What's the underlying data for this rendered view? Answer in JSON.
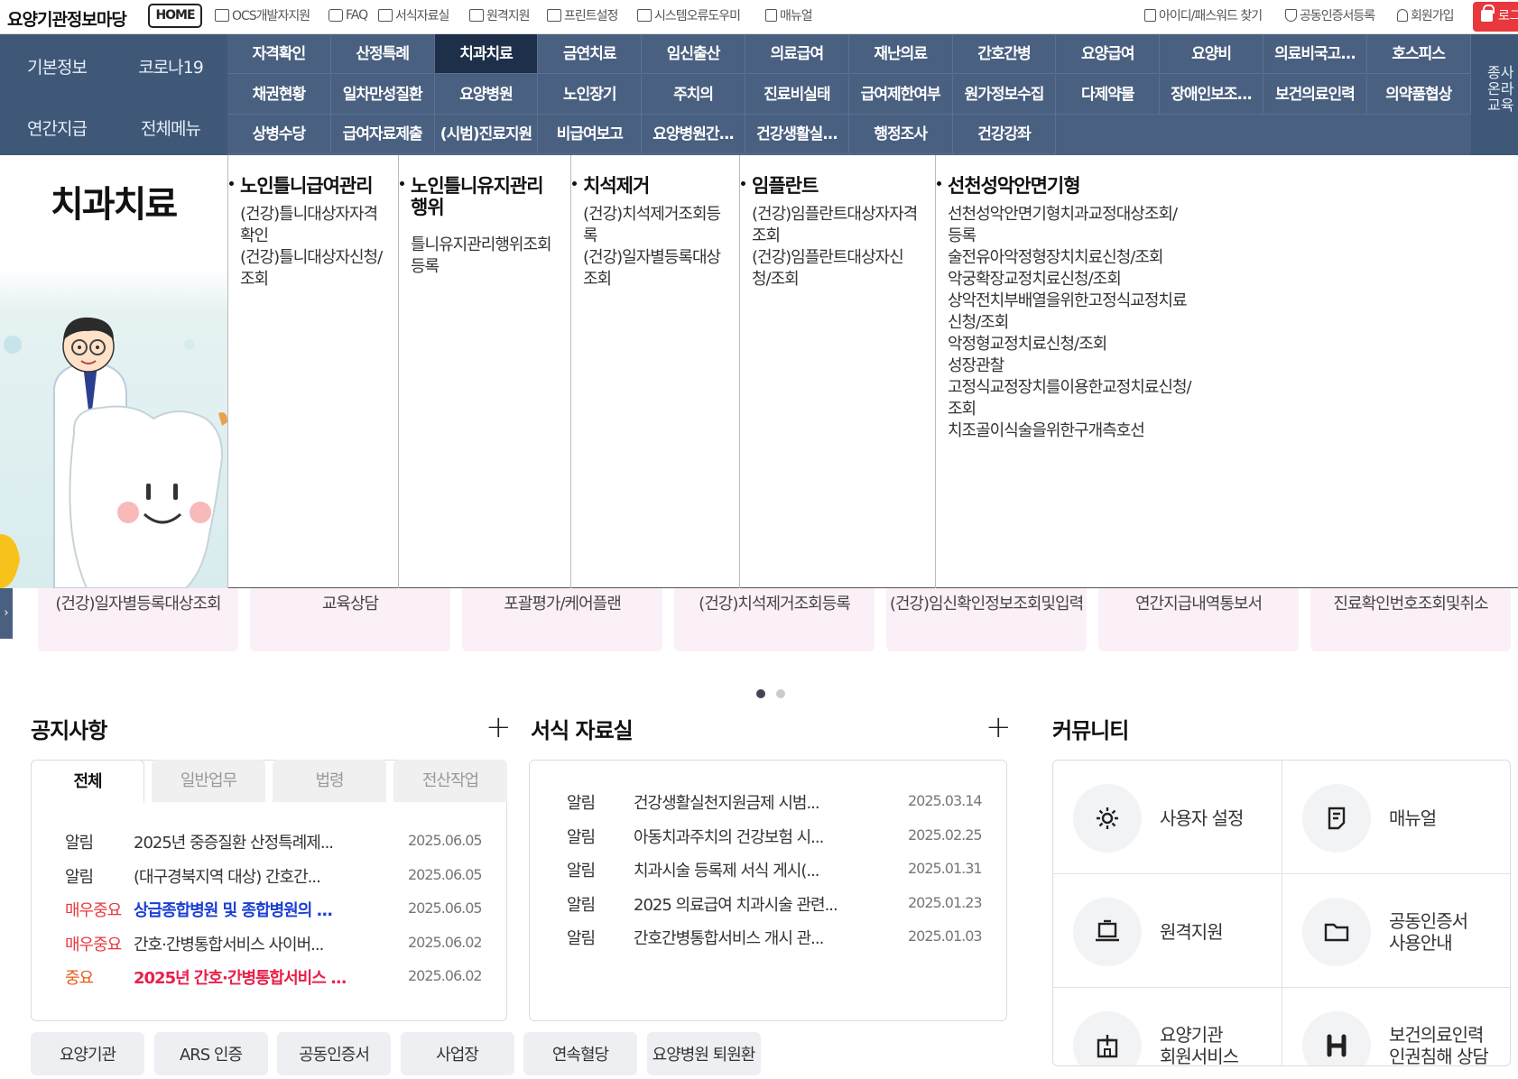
{
  "header": {
    "logo": "요양기관정보마당",
    "home": "HOME",
    "links": [
      {
        "label": "OCS개발자지원",
        "icon": "ocs-icon"
      },
      {
        "label": "FAQ",
        "icon": "chat-icon"
      },
      {
        "label": "서식자료실",
        "icon": "document-icon"
      },
      {
        "label": "원격지원",
        "icon": "monitor-icon"
      },
      {
        "label": "프린트설정",
        "icon": "printer-icon"
      },
      {
        "label": "시스템오류도우미",
        "icon": "printer-icon"
      },
      {
        "label": "매뉴얼",
        "icon": "manual-icon"
      }
    ],
    "right_links": [
      {
        "label": "아이디/패스워드 찾기",
        "icon": "id-icon"
      },
      {
        "label": "공동인증서등록",
        "icon": "shield-icon"
      },
      {
        "label": "회원가입",
        "icon": "person-icon"
      }
    ],
    "login": "로그인"
  },
  "nav": {
    "left": [
      "기본정보",
      "코로나19",
      "연간지급",
      "전체메뉴"
    ],
    "rows": [
      [
        "자격확인",
        "산정특례",
        "치과치료",
        "금연치료",
        "임신출산",
        "의료급여",
        "재난의료",
        "간호간병",
        "요양급여",
        "요양비",
        "의료비국고...",
        "호스피스"
      ],
      [
        "채권현황",
        "일차만성질환",
        "요양병원",
        "노인장기",
        "주치의",
        "진료비실태",
        "급여제한여부",
        "원가정보수집",
        "다제약물",
        "장애인보조...",
        "보건의료인력",
        "의약품협상"
      ],
      [
        "상병수당",
        "급여자료제출",
        "(시범)진료지원",
        "비급여보고",
        "요양병원간...",
        "건강생활실...",
        "행정조사",
        "건강강좌"
      ]
    ],
    "active": "치과치료",
    "right_text": [
      "종사",
      "온라",
      "교육"
    ]
  },
  "mega": {
    "title": "치과치료",
    "columns": [
      {
        "heading": [
          "노인틀니급여관리"
        ],
        "items": [
          "(건강)틀니대상자자격",
          "확인",
          "(건강)틀니대상자신청/",
          "조회"
        ]
      },
      {
        "heading": [
          "노인틀니유지관리",
          "행위"
        ],
        "items": [
          "틀니유지관리행위조회",
          "등록"
        ]
      },
      {
        "heading": [
          "치석제거"
        ],
        "items": [
          "(건강)치석제거조회등",
          "록",
          "(건강)일자별등록대상",
          "조회"
        ]
      },
      {
        "heading": [
          "임플란트"
        ],
        "items": [
          "(건강)임플란트대상자자격",
          "조회",
          "(건강)임플란트대상자신",
          "청/조회"
        ]
      },
      {
        "heading": [
          "선천성악안면기형"
        ],
        "items": [
          "선천성악안면기형치과교정대상조회/",
          "등록",
          "술전유아악정형장치치료신청/조회",
          "악궁확장교정치료신청/조회",
          "상악전치부배열을위한고정식교정치료",
          "신청/조회",
          "악정형교정치료신청/조회",
          "성장관찰",
          "고정식교정장치를이용한교정치료신청/",
          "조회",
          "치조골이식술을위한구개측호선"
        ]
      }
    ]
  },
  "quick": [
    "(건강)일자별등록대상조회",
    "교육상담",
    "포괄평가/케어플랜",
    "(건강)치석제거조회등록",
    "(건강)임신확인정보조회및입력",
    "연간지급내역통보서",
    "진료확인번호조회및취소"
  ],
  "notice": {
    "title": "공지사항",
    "tabs": [
      "전체",
      "일반업무",
      "법령",
      "전산작업"
    ],
    "rows": [
      {
        "tag": "알림",
        "text": "2025년 중증질환 산정특례제...",
        "date": "2025.06.05"
      },
      {
        "tag": "알림",
        "text": "(대구경북지역 대상) 간호간...",
        "date": "2025.06.05"
      },
      {
        "tag": "매우중요",
        "text": "상급종합병원 및 종합병원의 ...",
        "date": "2025.06.05"
      },
      {
        "tag": "매우중요",
        "text": "간호·간병통합서비스 사이버...",
        "date": "2025.06.02"
      },
      {
        "tag": "중요",
        "text": "2025년 간호·간병통합서비스 ...",
        "date": "2025.06.02"
      }
    ]
  },
  "forms": {
    "title": "서식 자료실",
    "rows": [
      {
        "tag": "알림",
        "text": "건강생활실천지원금제 시범...",
        "date": "2025.03.14"
      },
      {
        "tag": "알림",
        "text": "아동치과주치의 건강보험 시...",
        "date": "2025.02.25"
      },
      {
        "tag": "알림",
        "text": "치과시술 등록제 서식 게시(...",
        "date": "2025.01.31"
      },
      {
        "tag": "알림",
        "text": "2025 의료급여 치과시술 관련...",
        "date": "2025.01.23"
      },
      {
        "tag": "알림",
        "text": "간호간병통합서비스 개시 관...",
        "date": "2025.01.03"
      }
    ]
  },
  "community": {
    "title": "커뮤니티",
    "items": [
      {
        "label": [
          "사용자 설정"
        ],
        "icon": "gear-icon"
      },
      {
        "label": [
          "매뉴얼"
        ],
        "icon": "manual-icon"
      },
      {
        "label": [
          "원격지원"
        ],
        "icon": "laptop-icon"
      },
      {
        "label": [
          "공동인증서",
          "사용안내"
        ],
        "icon": "folder-icon"
      },
      {
        "label": [
          "요양기관",
          "회원서비스"
        ],
        "icon": "hospital-icon"
      },
      {
        "label": [
          "보건의료인력",
          "인권침해 상담"
        ],
        "icon": "hands-icon"
      }
    ]
  },
  "bottom_buttons": [
    "요양기관",
    "ARS 인증",
    "공동인증서",
    "사업장",
    "연속혈당",
    "요양병원 퇴원환"
  ],
  "colors": {
    "nav": "#4a6080",
    "nav_active": "#1e2f4a",
    "very_important": "#e8383d",
    "important_text": "#e8204a",
    "link_blue": "#1a3fd6"
  }
}
